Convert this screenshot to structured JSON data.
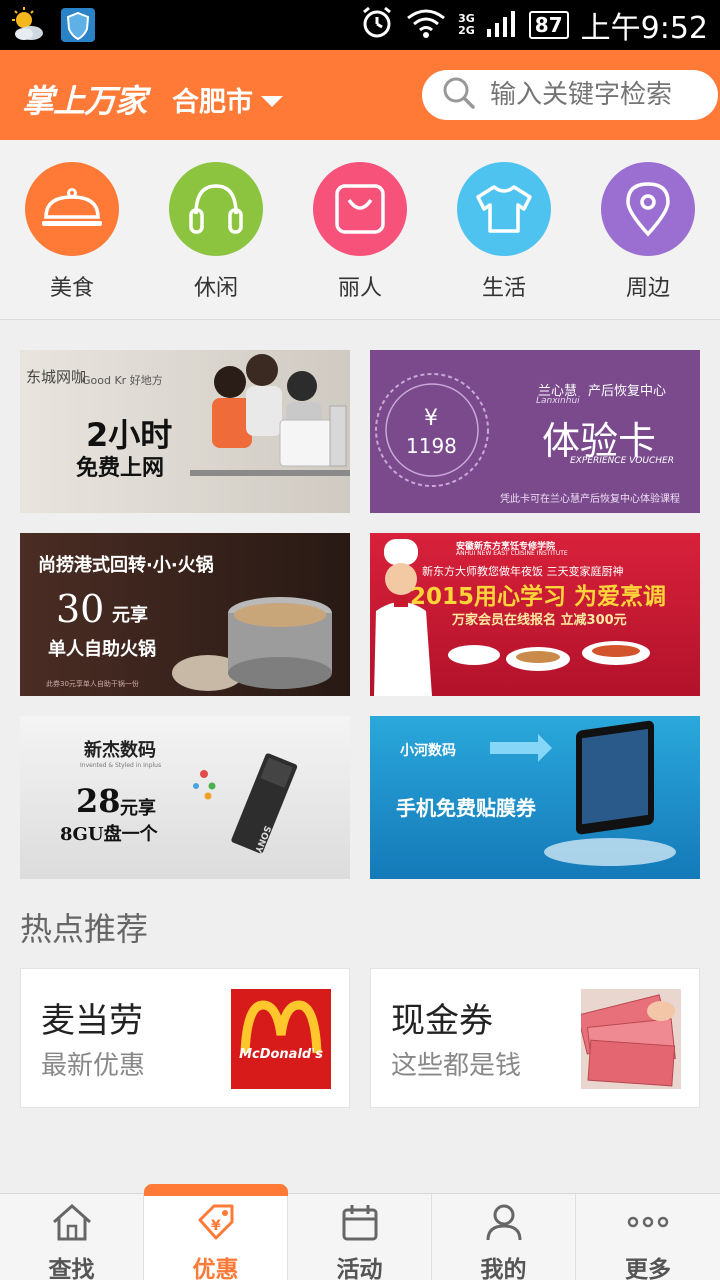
{
  "status_bar": {
    "network": "3G\n2G",
    "battery": "87",
    "time": "上午9:52"
  },
  "header": {
    "logo": "掌上万家",
    "city": "合肥市",
    "search_placeholder": "输入关键字检索"
  },
  "categories": [
    {
      "label": "美食",
      "color": "#fe7a36",
      "icon": "cloche-icon"
    },
    {
      "label": "休闲",
      "color": "#8cc43f",
      "icon": "headphones-icon"
    },
    {
      "label": "丽人",
      "color": "#f7527a",
      "icon": "bag-icon"
    },
    {
      "label": "生活",
      "color": "#4fc3f0",
      "icon": "tshirt-icon"
    },
    {
      "label": "周边",
      "color": "#9b6fd1",
      "icon": "location-pin-icon"
    }
  ],
  "banners": [
    {
      "brand": "东城网咖",
      "badge": "Good Kr 好地方",
      "line1": "2小时",
      "line2": "免费上网"
    },
    {
      "price_symbol": "¥",
      "price": "1198",
      "brand": "兰心慧",
      "brand_en": "Lanxinhui",
      "subtitle": "产后恢复中心",
      "title": "体验卡",
      "title_en": "EXPERIENCE VOUCHER",
      "note": "凭此卡可在兰心慧产后恢复中心体验课程"
    },
    {
      "title": "尚捞港式回转·小·火锅",
      "price": "30",
      "price_unit": "元享",
      "line2": "单人自助火锅",
      "note": "此券30元享单人自助干锅一份"
    },
    {
      "school": "安徽新东方烹饪专修学院",
      "school_en": "ANHUI NEW EAST CUISINE INSTITUTE",
      "slogan": "新东方大师教您做年夜饭 三天变家庭厨神",
      "title": "2015用心学习 为爱烹调",
      "line2": "万家会员在线报名 立减300元"
    },
    {
      "brand": "新杰数码",
      "brand_en": "Invented & Styled in Inplus",
      "price": "28",
      "price_unit": "元享",
      "line2": "8GU盘一个",
      "product": "SONY"
    },
    {
      "brand": "小河数码",
      "title": "手机免费贴膜券"
    }
  ],
  "hot": {
    "title": "热点推荐",
    "items": [
      {
        "name": "麦当劳",
        "sub": "最新优惠",
        "logo_text": "McDonald's"
      },
      {
        "name": "现金券",
        "sub": "这些都是钱"
      }
    ]
  },
  "bottom_nav": [
    {
      "label": "查找",
      "icon": "home-icon"
    },
    {
      "label": "优惠",
      "icon": "coupon-tag-icon",
      "active": true
    },
    {
      "label": "活动",
      "icon": "calendar-icon"
    },
    {
      "label": "我的",
      "icon": "user-icon"
    },
    {
      "label": "更多",
      "icon": "more-dots-icon"
    }
  ],
  "colors": {
    "accent": "#fe7a36",
    "background": "#efefef"
  }
}
